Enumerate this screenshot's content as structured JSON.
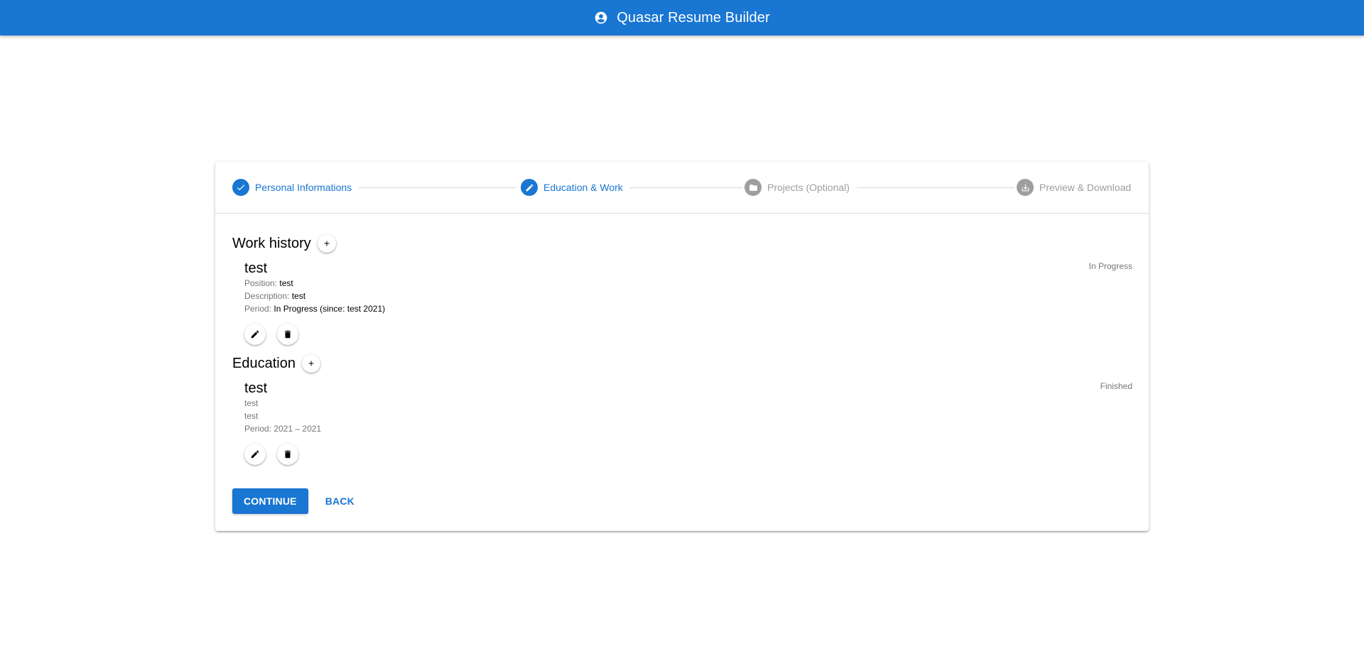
{
  "app": {
    "title": "Quasar Resume Builder",
    "accent": "#1976d2"
  },
  "stepper": {
    "steps": [
      {
        "label": "Personal Informations",
        "icon": "check-icon",
        "state": "done"
      },
      {
        "label": "Education & Work",
        "icon": "pencil-icon",
        "state": "active"
      },
      {
        "label": "Projects (Optional)",
        "icon": "folder-icon",
        "state": "pending"
      },
      {
        "label": "Preview & Download",
        "icon": "download-icon",
        "state": "pending"
      }
    ]
  },
  "work": {
    "title": "Work history",
    "entries": [
      {
        "name": "test",
        "status": "In Progress",
        "position_label": "Position:",
        "position": "test",
        "description_label": "Description:",
        "description": "test",
        "period_label": "Period:",
        "period": "In Progress (since: test 2021)"
      }
    ]
  },
  "education": {
    "title": "Education",
    "entries": [
      {
        "name": "test",
        "status": "Finished",
        "line1": "test",
        "line2": "test",
        "period": "Period: 2021 – 2021"
      }
    ]
  },
  "actions": {
    "continue_label": "CONTINUE",
    "back_label": "BACK"
  }
}
